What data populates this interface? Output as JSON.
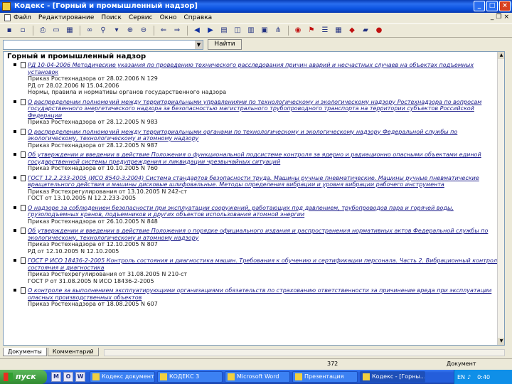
{
  "window": {
    "title": "Кодекс - [Горный и промышленный надзор]",
    "min_label": "_",
    "max_label": "□",
    "close_label": "×"
  },
  "menu": {
    "items": [
      "Файл",
      "Редактирование",
      "Поиск",
      "Сервис",
      "Окно",
      "Справка"
    ],
    "ctrl_min": "_",
    "ctrl_restore": "❐",
    "ctrl_close": "×"
  },
  "toolbar": {
    "icons": [
      "save-icon",
      "save-all-icon",
      "print-icon",
      "preview-icon",
      "calculator-icon",
      "binoculars-icon",
      "find-icon",
      "filter-icon",
      "zoom-in-icon",
      "zoom-out-icon",
      "back-arrow-icon",
      "forward-arrow-icon",
      "prev-doc-icon",
      "next-doc-icon",
      "tile-icon",
      "window-icon",
      "bookmark-icon",
      "note-icon",
      "tree-icon",
      "link-icon",
      "mark-icon",
      "list-icon",
      "calendar-icon",
      "flag-icon",
      "folder-icon",
      "info-icon"
    ]
  },
  "search": {
    "value": "",
    "find_label": "Найти"
  },
  "content": {
    "title": "Горный и промышленный надзор",
    "documents": [
      {
        "link": "РД 10-04-2006 Методические указания по проведению технического расследования причин аварий и несчастных случаев на объектах подъемных установок",
        "meta": [
          "Приказ Ростехнадзора от 28.02.2006 N 129",
          "РД от 28.02.2006 N 15.04.2006",
          "Нормы, правила и нормативы органов государственного надзора"
        ]
      },
      {
        "link": "О распределении полномочий между территориальными управлениями по технологическому и экологическому надзору Ростехнадзора по вопросам государственного энергетического надзора за безопасностью магистрального трубопроводного транспорта на территории субъектов Российской Федерации",
        "meta": [
          "Приказ Ростехнадзора от 28.12.2005 N 983"
        ]
      },
      {
        "link": "О распределении полномочий между территориальными органами по технологическому и экологическому надзору Федеральной службы по экологическому, технологическому и атомному надзору",
        "meta": [
          "Приказ Ростехнадзора от 28.12.2005 N 987"
        ]
      },
      {
        "link": "Об утверждении и введении в действие Положения о функциональной подсистеме контроля за ядерно и радиационно опасными объектами единой государственной системы предупреждения и ликвидации чрезвычайных ситуаций",
        "meta": [
          "Приказ Ростехнадзора от 10.10.2005 N 760"
        ]
      },
      {
        "link": "ГОСТ 12.2.233-2005 (ИСО 8540-3:2004) Система стандартов безопасности труда. Машины ручные пневматические. Машины ручные пневматические вращательного действия и машины дисковые шлифовальные. Методы определения вибрации и уровня вибрации рабочего инструмента",
        "meta": [
          "Приказ Ростехрегулирования от 13.10.2005 N 242-ст",
          "ГОСТ от 13.10.2005 N 12.2.233-2005"
        ]
      },
      {
        "link": "О надзоре за соблюдением безопасности при эксплуатации сооружений, работающих под давлением, трубопроводов пара и горячей воды, грузоподъемных кранов, подъемников и других объектов использования атомной энергии",
        "meta": [
          "Приказ Ростехнадзора от 26.10.2005 N 848"
        ]
      },
      {
        "link": "Об утверждении и введении в действие Положения о порядке официального издания и распространения нормативных актов Федеральной службы по экологическому, технологическому и атомному надзору",
        "meta": [
          "Приказ Ростехнадзора от 12.10.2005 N 807",
          "РД от 12.10.2005 N 12.10.2005"
        ]
      },
      {
        "link": "ГОСТ Р ИСО 18436-2-2005 Контроль состояния и диагностика машин. Требования к обучению и сертификации персонала. Часть 2. Вибрационный контроль состояния и диагностика",
        "meta": [
          "Приказ Ростехрегулирования от 31.08.2005 N 210-ст",
          "ГОСТ Р от 31.08.2005 N ИСО 18436-2-2005"
        ]
      },
      {
        "link": "О контроле за выполнением эксплуатирующими организациями обязательств по страхованию ответственности за причинение вреда при эксплуатации опасных производственных объектов",
        "meta": [
          "Приказ Ростехнадзора от 18.08.2005 N 607"
        ]
      }
    ]
  },
  "tabs": [
    "Документы",
    "Комментарий"
  ],
  "status": {
    "count": "372",
    "mode": "Документ"
  },
  "taskbar": {
    "start_label": "пуск",
    "quick": [
      "M",
      "O",
      "W"
    ],
    "tasks": [
      "Кодекс документы",
      "КОДЕКС 3",
      "Microsoft Word",
      "Презентация",
      "Кодекс - [Горны..."
    ],
    "lang": "EN",
    "clock": "0:40"
  },
  "colors": {
    "link": "#1a1a8a",
    "titlebar": "#0a52e0",
    "taskbar": "#245edb"
  }
}
